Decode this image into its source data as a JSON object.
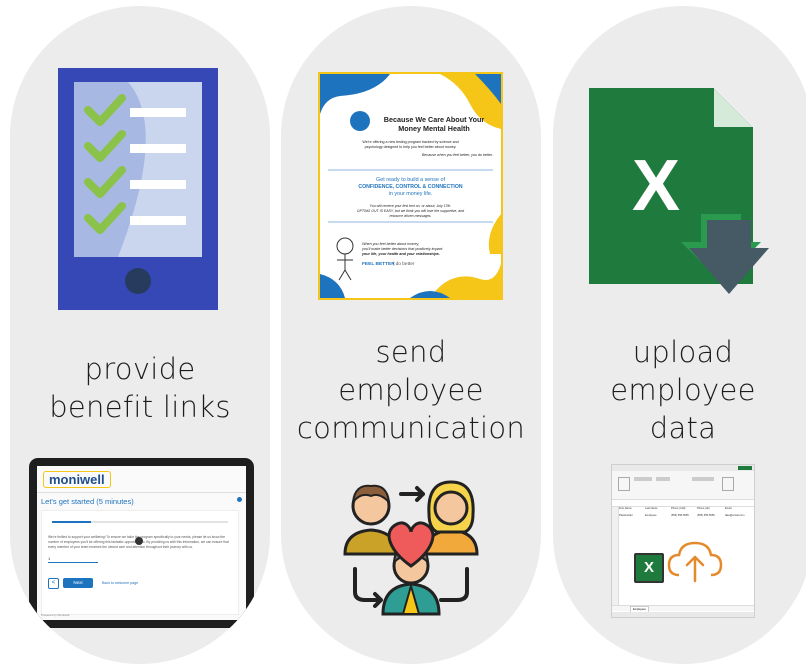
{
  "columns": [
    {
      "label_lines": [
        "provide",
        "benefit links"
      ]
    },
    {
      "label_lines": [
        "send",
        "employee",
        "communication"
      ]
    },
    {
      "label_lines": [
        "upload",
        "employee",
        "data"
      ]
    }
  ],
  "flyer": {
    "headline_1": "Because We Care About Your",
    "headline_2": "Money Mental Health",
    "intro_1": "We're offering a new testing program backed by science and",
    "intro_2": "psychology designed to help you feel better about money.",
    "tagline": "Because when you feel better, you do better.",
    "ready": "Get ready to build a sense of",
    "ccc": "CONFIDENCE, CONTROL & CONNECTION",
    "money_life": "in your money life.",
    "receive_1": "You will receive your first text on, or about, July 17th.",
    "receive_2": "OPTING OUT IS EASY, but we think you will love the supportive, and",
    "receive_3": "resource driven messages.",
    "bottom_1": "When you feel better about money,",
    "bottom_2": "you'll make better decisions that positively impact",
    "bottom_3": "your life, your health and your relationships.",
    "feel_better": "FEEL BETTER",
    "do_better": "| do better"
  },
  "tablet": {
    "brand": "moniwell",
    "heading": "Let's get started (5 minutes)",
    "body": "We're thrilled to support your wellbeing! To ensure we tailor the program specifically to your needs, please let us know the number of employees you'll be offering this fantastic opportunity to. By providing us with this information, we can ensure that every member of your team receives the utmost care and attention throughout their journey with us.",
    "input_value": "1",
    "back_label": "<",
    "next_label": "Next",
    "link_label": "Back to welcome page",
    "footer": "Powered by Moniwell"
  },
  "sheet": {
    "headers": [
      "First Name",
      "Last Name",
      "Phone (Cell)",
      "Phone (alt)",
      "Email"
    ],
    "row": [
      "Placeholder",
      "Employee",
      "(555) 555-5555",
      "(555) 555-5555",
      "fake@email.com"
    ],
    "tab": "Employees",
    "excel_letter": "X"
  },
  "icons": {
    "excel_letter": "X"
  },
  "colors": {
    "column_bg": "#ececec",
    "tablet_blue": "#3647b6",
    "check_green": "#8bc34a",
    "excel_green": "#1f7a3e",
    "arrow_slate": "#455a64",
    "flyer_yellow": "#f5c518",
    "flyer_blue": "#1e73be"
  }
}
